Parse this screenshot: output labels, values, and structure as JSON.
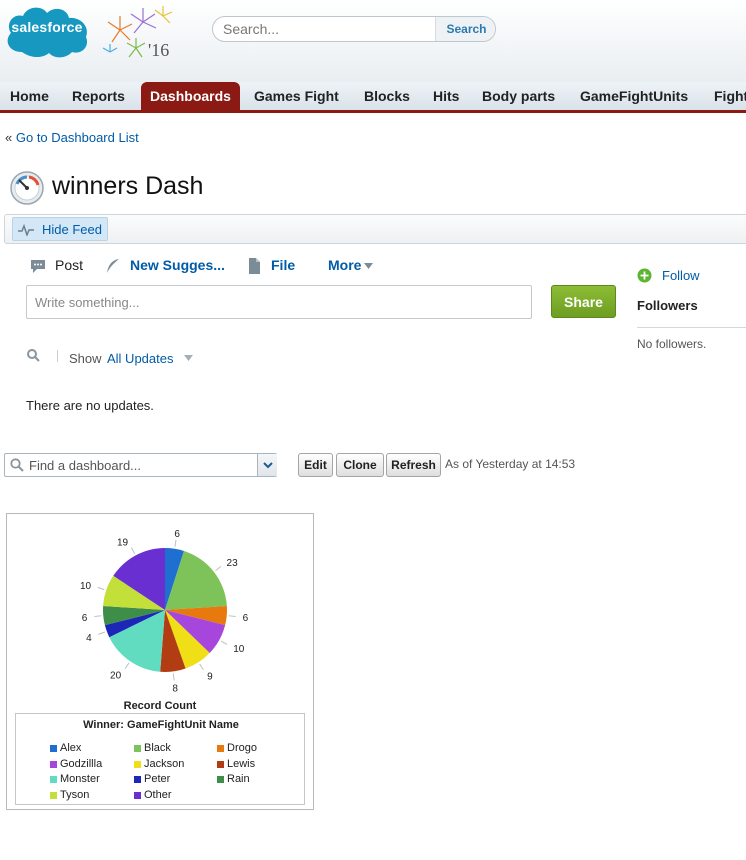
{
  "brand": {
    "logo_text": "salesforce",
    "year_text": "'16"
  },
  "search": {
    "placeholder": "Search...",
    "button_label": "Search"
  },
  "tabs": [
    {
      "label": "Home",
      "active": false
    },
    {
      "label": "Reports",
      "active": false
    },
    {
      "label": "Dashboards",
      "active": true
    },
    {
      "label": "Games Fight",
      "active": false
    },
    {
      "label": "Blocks",
      "active": false
    },
    {
      "label": "Hits",
      "active": false
    },
    {
      "label": "Body parts",
      "active": false
    },
    {
      "label": "GameFightUnits",
      "active": false
    },
    {
      "label": "Fight",
      "active": false
    }
  ],
  "breadcrumb": {
    "prefix": "«",
    "link": "Go to Dashboard List"
  },
  "page": {
    "title": "winners Dash"
  },
  "feed": {
    "hide_feed_label": "Hide Feed",
    "publisher_tabs": [
      {
        "label": "Post",
        "icon": "speech-bubble-icon"
      },
      {
        "label": "New Sugges...",
        "icon": "feather-icon"
      },
      {
        "label": "File",
        "icon": "file-icon"
      },
      {
        "label": "More",
        "icon": "caret-down-icon"
      }
    ],
    "write_placeholder": "Write something...",
    "share_label": "Share",
    "filter": {
      "show_label": "Show",
      "show_value": "All Updates"
    },
    "empty_text": "There are no updates."
  },
  "followers": {
    "follow_label": "Follow",
    "title": "Followers",
    "empty_text": "No followers."
  },
  "dashboard_toolbar": {
    "find_placeholder": "Find a dashboard...",
    "edit_label": "Edit",
    "clone_label": "Clone",
    "refresh_label": "Refresh",
    "as_of_text": "As of Yesterday at 14:53"
  },
  "chart_data": {
    "type": "pie",
    "title": "Record Count",
    "legend_title": "Winner: GameFightUnit Name",
    "legend_position": "bottom",
    "slices": [
      {
        "label": "Alex",
        "value": 6,
        "color": "#1f6fd1"
      },
      {
        "label": "Black",
        "value": 23,
        "color": "#7ec35a"
      },
      {
        "label": "Drogo",
        "value": 6,
        "color": "#e8790f"
      },
      {
        "label": "Godzillla",
        "value": 10,
        "color": "#a646dc"
      },
      {
        "label": "Jackson",
        "value": 9,
        "color": "#f0de16"
      },
      {
        "label": "Lewis",
        "value": 8,
        "color": "#b33d12"
      },
      {
        "label": "Monster",
        "value": 20,
        "color": "#62dcc0"
      },
      {
        "label": "Peter",
        "value": 4,
        "color": "#1c27b8"
      },
      {
        "label": "Rain",
        "value": 6,
        "color": "#3e8e49"
      },
      {
        "label": "Tyson",
        "value": 10,
        "color": "#c3df3a"
      },
      {
        "label": "Other",
        "value": 19,
        "color": "#6a2fd0"
      }
    ]
  }
}
